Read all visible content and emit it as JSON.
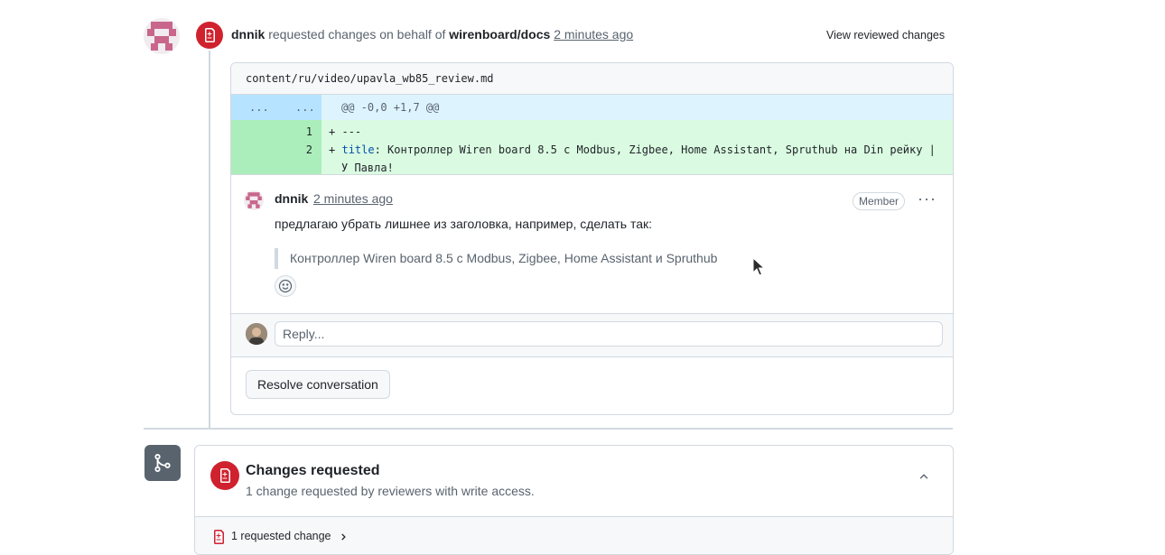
{
  "review": {
    "author": "dnnik",
    "action": "requested changes on behalf of",
    "org": "wirenboard/docs",
    "time": "2 minutes ago",
    "view_changes": "View reviewed changes"
  },
  "file": {
    "path": "content/ru/video/upavla_wb85_review.md",
    "hunk_gutter_left": "...",
    "hunk_gutter_right": "...",
    "hunk_header": "@@ -0,0 +1,7 @@",
    "lines": [
      {
        "num": "1",
        "sign": "+",
        "text": "---"
      },
      {
        "num": "2",
        "sign": "+",
        "key": "title",
        "text": ": Контроллер Wiren board 8.5 с Modbus, Zigbee, Home Assistant, Spruthub на Din рейку |",
        "cont": "У Павла!"
      }
    ]
  },
  "comment": {
    "author": "dnnik",
    "time": "2 minutes ago",
    "badge": "Member",
    "menu": "···",
    "body": "предлагаю убрать лишнее из заголовка, например, сделать так:",
    "quote": "Контроллер Wiren board 8.5 с Modbus, Zigbee, Home Assistant и Spruthub"
  },
  "reply": {
    "placeholder": "Reply..."
  },
  "resolve": {
    "label": "Resolve conversation"
  },
  "merge_box": {
    "title": "Changes requested",
    "subtitle": "1 change requested by reviewers with write access.",
    "footer": "1 requested change"
  },
  "colors": {
    "danger": "#cf222e",
    "addition_bg": "#dafbe1",
    "addition_gutter": "#aceebb",
    "hunk_bg": "#ddf4ff"
  }
}
